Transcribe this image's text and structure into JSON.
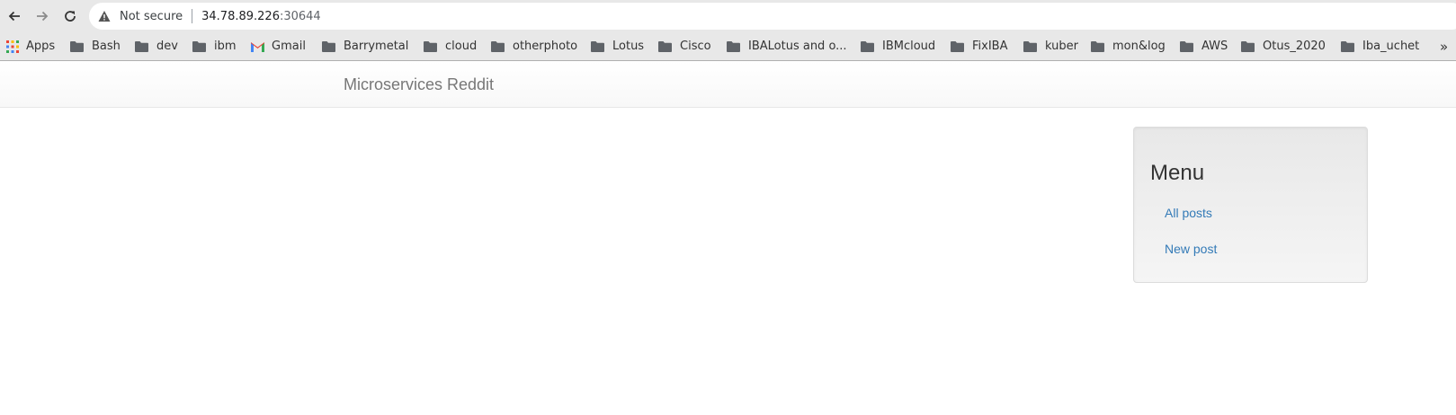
{
  "browser": {
    "security_label": "Not secure",
    "url_host": "34.78.89.226",
    "url_port": ":30644",
    "icons": [
      "back-arrow-icon",
      "forward-arrow-icon",
      "reload-icon",
      "warning-triangle-icon"
    ]
  },
  "bookmarks": {
    "items": [
      {
        "label": "Apps",
        "icon": "apps-grid-icon"
      },
      {
        "label": "Bash",
        "icon": "folder-icon"
      },
      {
        "label": "dev",
        "icon": "folder-icon"
      },
      {
        "label": "ibm",
        "icon": "folder-icon"
      },
      {
        "label": "Gmail",
        "icon": "gmail-icon"
      },
      {
        "label": "Barrymetal",
        "icon": "folder-icon"
      },
      {
        "label": "cloud",
        "icon": "folder-icon"
      },
      {
        "label": "otherphoto",
        "icon": "folder-icon"
      },
      {
        "label": "Lotus",
        "icon": "folder-icon"
      },
      {
        "label": "Cisco",
        "icon": "folder-icon"
      },
      {
        "label": "IBALotus and o...",
        "icon": "folder-icon"
      },
      {
        "label": "IBMcloud",
        "icon": "folder-icon"
      },
      {
        "label": "FixIBA",
        "icon": "folder-icon"
      },
      {
        "label": "kuber",
        "icon": "folder-icon"
      },
      {
        "label": "mon&log",
        "icon": "folder-icon"
      },
      {
        "label": "AWS",
        "icon": "folder-icon"
      },
      {
        "label": "Otus_2020",
        "icon": "folder-icon"
      },
      {
        "label": "Iba_uchet",
        "icon": "folder-icon"
      }
    ],
    "more_label": "»"
  },
  "page": {
    "brand": "Microservices Reddit",
    "menu": {
      "title": "Menu",
      "links": [
        {
          "label": "All posts"
        },
        {
          "label": "New post"
        }
      ]
    }
  },
  "colors": {
    "link": "#337ab7",
    "brand_text": "#777777",
    "chrome_bg": "#e8e8e8"
  }
}
